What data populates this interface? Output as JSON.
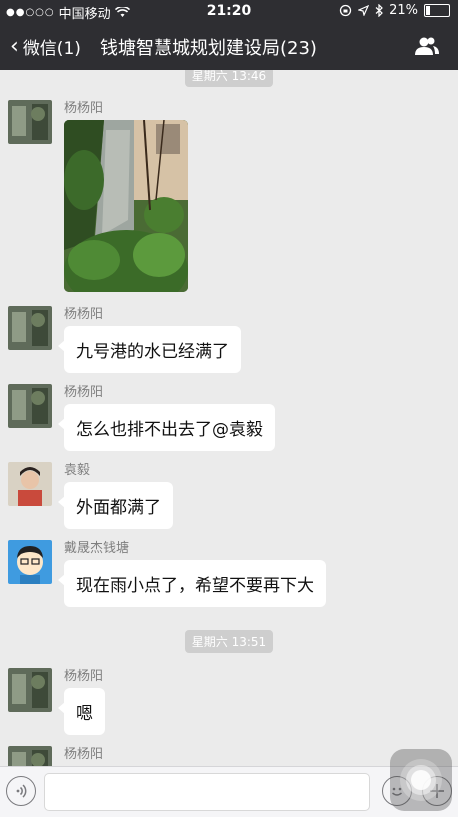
{
  "status_bar": {
    "signal": "●●○○○",
    "carrier": "中国移动",
    "time": "21:20",
    "battery": "21%",
    "battery_level": 0.21,
    "icons": [
      "wifi-icon",
      "rotation-lock-icon",
      "location-icon",
      "bluetooth-icon",
      "battery-icon"
    ]
  },
  "nav": {
    "back_label": "微信(1)",
    "title": "钱塘智慧城规划建设局(23)",
    "right_icon": "group-members-icon"
  },
  "chat": {
    "timestamps": [
      "星期六 13:46",
      "星期六 13:51"
    ],
    "messages": [
      {
        "sender": "杨杨阳",
        "type": "image",
        "text": ""
      },
      {
        "sender": "杨杨阳",
        "type": "text",
        "text": "九号港的水已经满了"
      },
      {
        "sender": "杨杨阳",
        "type": "text",
        "text": "怎么也排不出去了@袁毅"
      },
      {
        "sender": "袁毅",
        "type": "text",
        "text": "外面都满了"
      },
      {
        "sender": "戴晟杰钱塘",
        "type": "text",
        "text": "现在雨小点了，希望不要再下大"
      },
      {
        "sender": "杨杨阳",
        "type": "text",
        "text": "嗯"
      },
      {
        "sender": "杨杨阳",
        "type": "text",
        "text": ""
      }
    ]
  },
  "bottom_bar": {
    "icons": [
      "voice-icon",
      "emoji-icon",
      "plus-icon"
    ],
    "input_value": ""
  },
  "colors": {
    "nav_background": "#2e2e32",
    "chat_background": "#ebebeb",
    "bubble": "#ffffff"
  }
}
